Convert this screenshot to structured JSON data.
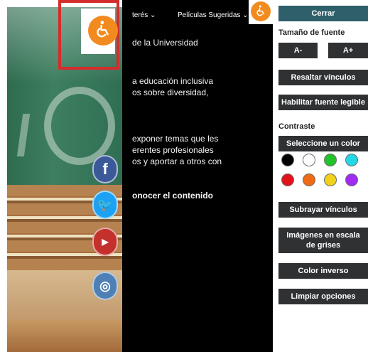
{
  "middle_panel": {
    "nav": {
      "item1": "terés ⌄",
      "item2": "Películas Sugeridas ⌄"
    },
    "text": [
      "de la Universidad",
      "a educación inclusiva",
      "os sobre diversidad,",
      "exponer temas que les",
      "erentes profesionales",
      "os y aportar a otros con",
      "onocer el contenido"
    ]
  },
  "accessibility_panel": {
    "close_label": "Cerrar",
    "font_size_label": "Tamaño de fuente",
    "font_decrease": "A-",
    "font_increase": "A+",
    "highlight_links": "Resaltar vínculos",
    "readable_font": "Habilitar fuente legible",
    "contrast_label": "Contraste",
    "select_color": "Seleccione un color",
    "colors": [
      "#000000",
      "#ffffff",
      "#22c22a",
      "#22d7e6",
      "#e3121a",
      "#f06b14",
      "#f0d21a",
      "#a32af0"
    ],
    "underline_links": "Subrayar vínculos",
    "grayscale_images": "Imágenes en escala de grises",
    "inverse_color": "Color inverso",
    "clear_options": "Limpiar opciones"
  },
  "social_icons": [
    "facebook-icon",
    "twitter-icon",
    "youtube-icon",
    "instagram-icon"
  ],
  "accessibility_icon": "wheelchair-icon",
  "colors": {
    "accent_orange": "#f28b1f",
    "panel_dark": "#2f3133",
    "close_button": "#2f5f6a"
  }
}
